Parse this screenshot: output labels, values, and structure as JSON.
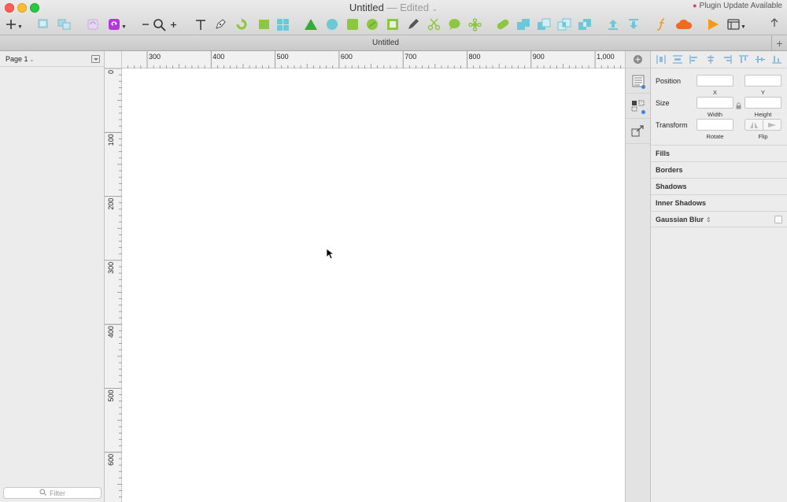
{
  "window": {
    "title": "Untitled",
    "edited_label": "— Edited",
    "plugin_update": "Plugin Update Available"
  },
  "toolbar": {
    "icons": [
      "insert-icon",
      "group-icon",
      "ungroup-icon",
      "symbol-icon",
      "plugin-icon",
      "zoom-minus-icon",
      "zoom-icon",
      "zoom-plus-icon",
      "text-icon",
      "pen-icon",
      "rotate-icon",
      "rectangle-icon",
      "grid-icon",
      "triangle-icon",
      "oval-icon",
      "square-icon",
      "circle-icon",
      "frame-icon",
      "pencil-icon",
      "scissors-icon",
      "speech-bubble-icon",
      "star-icon",
      "flower-icon",
      "link-icon",
      "union-icon",
      "subtract-icon",
      "intersect-icon",
      "difference-icon",
      "upload-icon",
      "download-icon",
      "script-icon",
      "cloud-icon",
      "play-icon",
      "view-icon",
      "share-icon"
    ]
  },
  "tabbar": {
    "doc_title": "Untitled",
    "add_label": "+"
  },
  "left_panel": {
    "page_label": "Page 1",
    "filter_placeholder": "Filter"
  },
  "rulers": {
    "horizontal_ticks": [
      "300",
      "400",
      "500",
      "600",
      "700",
      "800",
      "900",
      "1,000"
    ],
    "vertical_ticks": [
      "0",
      "100",
      "200",
      "300",
      "400",
      "500",
      "600"
    ]
  },
  "inspector": {
    "position_label": "Position",
    "x_label": "X",
    "y_label": "Y",
    "size_label": "Size",
    "width_label": "Width",
    "height_label": "Height",
    "transform_label": "Transform",
    "rotate_label": "Rotate",
    "flip_label": "Flip",
    "sections": [
      "Fills",
      "Borders",
      "Shadows",
      "Inner Shadows",
      "Gaussian Blur"
    ]
  },
  "colors": {
    "accent_purple": "#b23ad9",
    "shape_teal": "#6cc8d6",
    "triangle_green": "#3aa83a",
    "cloud_orange": "#f06a22",
    "play_orange": "#f39a17"
  }
}
